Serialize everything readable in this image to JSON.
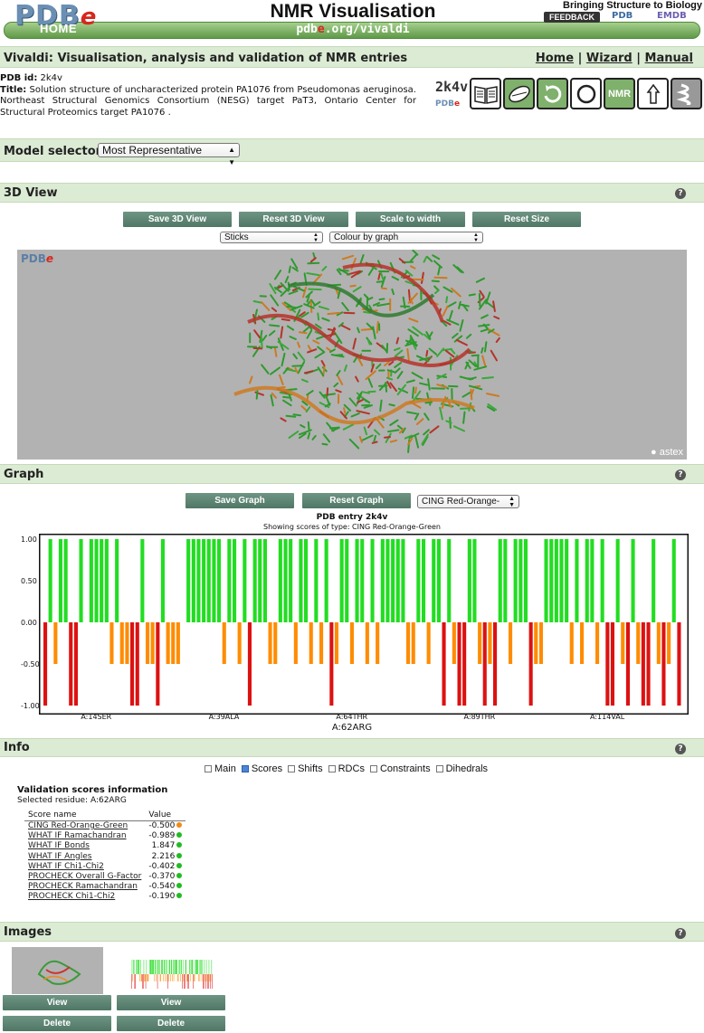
{
  "banner": {
    "logo": "PDB",
    "logo_e": "e",
    "home": "HOME",
    "title": "NMR Visualisation",
    "url_prefix": "pdb",
    "url_e": "e",
    "url_suffix": ".org/vivaldi",
    "tagline": "Bringing Structure to Biology",
    "feedback": "FEEDBACK",
    "pdb_logo": "PDB",
    "emdb_logo": "EMDB"
  },
  "header": {
    "title": "Vivaldi: Visualisation, analysis and validation of NMR entries",
    "nav": [
      "Home",
      "Wizard",
      "Manual"
    ],
    "separator": "|"
  },
  "entry": {
    "pdb_id_label": "PDB id:",
    "pdb_id": "2k4v",
    "title_label": "Title:",
    "title": "Solution structure of uncharacterized protein PA1076 from Pseudomonas aeruginosa. Northeast Structural Genomics Consortium (NESG) target PaT3, Ontario Center for Structural Proteomics target PA1076 .",
    "code": "2k4v",
    "pdbe_small": "PDB",
    "pdbe_small_e": "e",
    "icons": [
      "book-icon",
      "pill-icon",
      "refresh-icon",
      "cycle-icon",
      "nmr-icon",
      "arrow-up-icon",
      "helix-icon",
      "hexagon-icon"
    ],
    "nmr_label": "NMR"
  },
  "model_selector": {
    "label": "Model selector:",
    "value": "Most Representative"
  },
  "view3d": {
    "title": "3D View",
    "help": "?",
    "buttons": [
      "Save 3D View",
      "Reset 3D View",
      "Scale to width",
      "Reset Size"
    ],
    "style_select": "Sticks",
    "colour_select": "Colour by graph",
    "viewer_logo": "PDB",
    "viewer_logo_e": "e",
    "astex": "astex"
  },
  "graph": {
    "title": "Graph",
    "help": "?",
    "buttons": [
      "Save Graph",
      "Reset Graph"
    ],
    "type_select": "CING Red-Orange-",
    "chart_title": "PDB entry 2k4v",
    "chart_subtitle": "Showing scores of type: CING Red-Orange-Green",
    "selected_label": "A:62ARG"
  },
  "chart_data": {
    "type": "bar",
    "title": "PDB entry 2k4v",
    "subtitle": "Showing scores of type: CING Red-Orange-Green",
    "ylim": [
      -1,
      1
    ],
    "yticks": [
      "1.00",
      "0.50",
      "0.00",
      "-0.50",
      "-1.00"
    ],
    "xticks": [
      "A:14SER",
      "A:39ALA",
      "A:64THR",
      "A:89THR",
      "A:114VAL"
    ],
    "xtick_residues": [
      14,
      39,
      64,
      89,
      114
    ],
    "residue_range": [
      4,
      128
    ],
    "colors": {
      "green": "#22dd22",
      "orange": "#ff8c00",
      "red": "#dd1111"
    },
    "residues": [
      4,
      5,
      6,
      7,
      8,
      9,
      10,
      11,
      12,
      13,
      14,
      15,
      16,
      17,
      18,
      19,
      20,
      21,
      22,
      23,
      24,
      25,
      26,
      27,
      28,
      29,
      30,
      31,
      32,
      33,
      34,
      35,
      36,
      37,
      38,
      39,
      40,
      41,
      42,
      43,
      44,
      45,
      46,
      47,
      48,
      49,
      50,
      51,
      52,
      53,
      54,
      55,
      56,
      57,
      58,
      59,
      60,
      61,
      62,
      63,
      64,
      65,
      66,
      67,
      68,
      69,
      70,
      71,
      72,
      73,
      74,
      75,
      76,
      77,
      78,
      79,
      80,
      81,
      82,
      83,
      84,
      85,
      86,
      87,
      88,
      89,
      90,
      91,
      92,
      93,
      94,
      95,
      96,
      97,
      98,
      99,
      100,
      101,
      102,
      103,
      104,
      105,
      106,
      107,
      108,
      109,
      110,
      111,
      112,
      113,
      114,
      115,
      116,
      117,
      118,
      119,
      120,
      121,
      122,
      123,
      124,
      125,
      126,
      127,
      128
    ],
    "values": [
      -1,
      1,
      -0.5,
      1,
      1,
      -1,
      -1,
      1,
      0,
      1,
      1,
      1,
      1,
      -0.5,
      1,
      -0.5,
      -0.5,
      -1,
      -1,
      1,
      -0.5,
      -0.5,
      -1,
      1,
      -0.5,
      -0.5,
      -0.5,
      0,
      1,
      1,
      1,
      1,
      1,
      1,
      1,
      -0.5,
      1,
      1,
      -0.5,
      1,
      -1,
      1,
      1,
      1,
      -0.5,
      -0.5,
      1,
      1,
      1,
      -0.5,
      1,
      1,
      -0.5,
      1,
      -0.5,
      1,
      -1,
      -0.5,
      1,
      1,
      -0.5,
      1,
      1,
      -0.5,
      1,
      -0.5,
      1,
      1,
      1,
      1,
      1,
      -0.5,
      -0.5,
      1,
      1,
      -0.5,
      1,
      1,
      -1,
      1,
      -0.5,
      -1,
      -1,
      1,
      1,
      -0.5,
      -1,
      -0.5,
      -1,
      1,
      1,
      -0.5,
      1,
      1,
      1,
      -1,
      -0.5,
      -0.5,
      1,
      1,
      1,
      1,
      1,
      -0.5,
      1,
      -0.5,
      1,
      1,
      -0.5,
      1,
      -1,
      -1,
      1,
      -0.5,
      -1,
      1,
      -0.5,
      -1,
      -1,
      1,
      -0.5,
      -1,
      -0.5,
      1,
      -1
    ],
    "color_keys": [
      "red",
      "green",
      "orange",
      "green",
      "green",
      "red",
      "red",
      "green",
      "green",
      "green",
      "green",
      "green",
      "green",
      "orange",
      "green",
      "orange",
      "orange",
      "red",
      "red",
      "green",
      "orange",
      "orange",
      "red",
      "green",
      "orange",
      "orange",
      "orange",
      "green",
      "green",
      "green",
      "green",
      "green",
      "green",
      "green",
      "green",
      "orange",
      "green",
      "green",
      "orange",
      "green",
      "red",
      "green",
      "green",
      "green",
      "orange",
      "orange",
      "green",
      "green",
      "green",
      "orange",
      "green",
      "green",
      "orange",
      "green",
      "orange",
      "green",
      "red",
      "orange",
      "green",
      "green",
      "orange",
      "green",
      "green",
      "orange",
      "green",
      "orange",
      "green",
      "green",
      "green",
      "green",
      "green",
      "orange",
      "orange",
      "green",
      "green",
      "orange",
      "green",
      "green",
      "red",
      "green",
      "orange",
      "red",
      "red",
      "green",
      "green",
      "orange",
      "red",
      "orange",
      "red",
      "green",
      "green",
      "orange",
      "green",
      "green",
      "green",
      "red",
      "orange",
      "orange",
      "green",
      "green",
      "green",
      "green",
      "green",
      "orange",
      "green",
      "orange",
      "green",
      "green",
      "orange",
      "green",
      "red",
      "red",
      "green",
      "orange",
      "red",
      "green",
      "orange",
      "red",
      "red",
      "green",
      "orange",
      "red",
      "orange",
      "green",
      "red"
    ]
  },
  "info": {
    "title": "Info",
    "help": "?",
    "checkboxes": [
      {
        "label": "Main",
        "checked": false
      },
      {
        "label": "Scores",
        "checked": true
      },
      {
        "label": "Shifts",
        "checked": false
      },
      {
        "label": "RDCs",
        "checked": false
      },
      {
        "label": "Constraints",
        "checked": false
      },
      {
        "label": "Dihedrals",
        "checked": false
      }
    ],
    "vs_title": "Validation scores information",
    "selected_residue": "Selected residue: A:62ARG",
    "table_headers": [
      "Score name",
      "Value"
    ],
    "scores": [
      {
        "name": "CING Red-Orange-Green",
        "value": "-0.500",
        "color": "#f08a1a"
      },
      {
        "name": "WHAT IF Ramachandran",
        "value": "-0.989",
        "color": "#22bb22"
      },
      {
        "name": "WHAT IF Bonds",
        "value": "1.847",
        "color": "#22bb22"
      },
      {
        "name": "WHAT IF Angles",
        "value": "2.216",
        "color": "#22bb22"
      },
      {
        "name": "WHAT IF Chi1-Chi2",
        "value": "-0.402",
        "color": "#22bb22"
      },
      {
        "name": "PROCHECK Overall G-Factor",
        "value": "-0.370",
        "color": "#22bb22"
      },
      {
        "name": "PROCHECK Ramachandran",
        "value": "-0.540",
        "color": "#22bb22"
      },
      {
        "name": "PROCHECK Chi1-Chi2",
        "value": "-0.190",
        "color": "#22bb22"
      }
    ]
  },
  "images": {
    "title": "Images",
    "help": "?",
    "view_label": "View",
    "delete_label": "Delete"
  }
}
